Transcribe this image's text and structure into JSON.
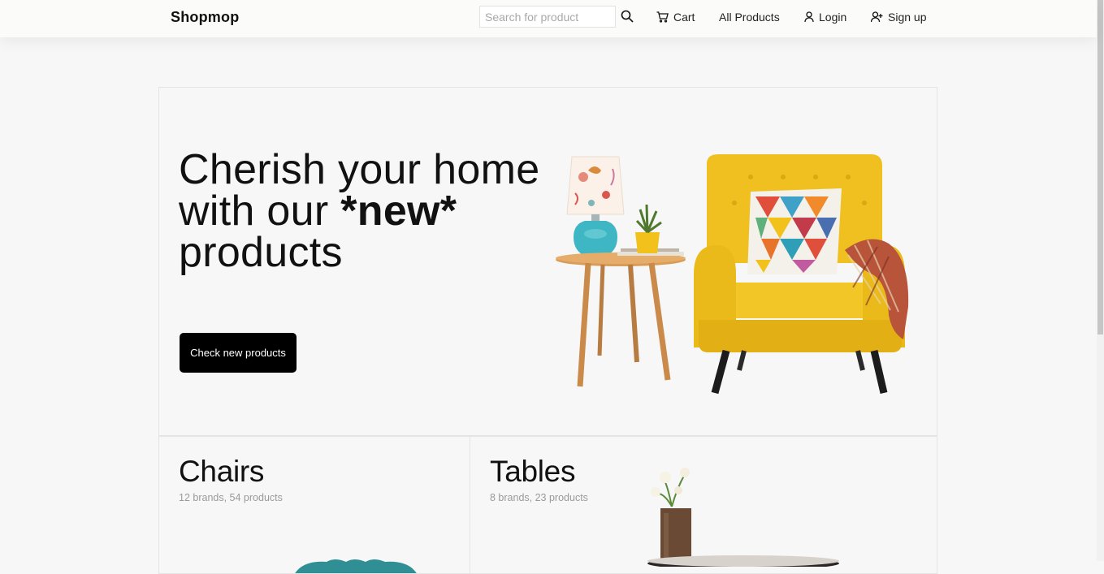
{
  "header": {
    "brand": "Shopmop",
    "search": {
      "placeholder": "Search for product",
      "value": ""
    },
    "nav": {
      "cart": "Cart",
      "all_products": "All Products",
      "login": "Login",
      "signup": "Sign up"
    }
  },
  "hero": {
    "title_line1": "Cherish your home",
    "title_line2_prefix": "with our ",
    "title_highlight": "*new*",
    "title_line3": "products",
    "cta_label": "Check new products"
  },
  "categories": [
    {
      "title": "Chairs",
      "subtitle": "12 brands, 54 products"
    },
    {
      "title": "Tables",
      "subtitle": "8 brands, 23 products"
    }
  ],
  "colors": {
    "accent": "#000000",
    "chair_yellow": "#efc01f",
    "lamp_teal": "#3fb6c3"
  }
}
